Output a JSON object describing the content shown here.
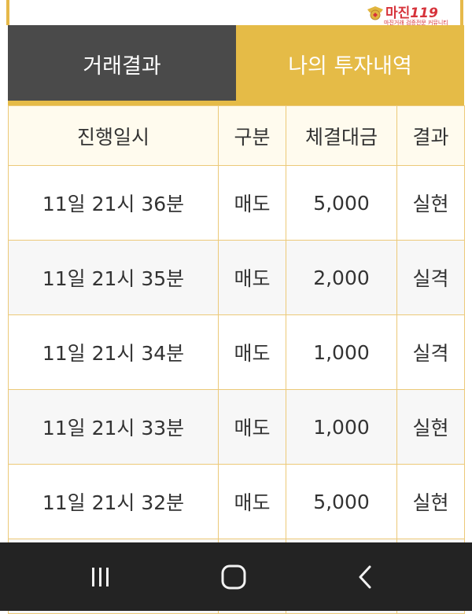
{
  "logo": {
    "name": "마진",
    "number": "119",
    "tagline": "마진거래 검증전문 커뮤니티"
  },
  "tabs": [
    {
      "label": "거래결과",
      "active": false
    },
    {
      "label": "나의 투자내역",
      "active": true
    }
  ],
  "table": {
    "headers": [
      "진행일시",
      "구분",
      "체결대금",
      "결과"
    ],
    "rows": [
      {
        "time": "11일 21시 36분",
        "type": "매도",
        "amount": "5,000",
        "result": "실현"
      },
      {
        "time": "11일 21시 35분",
        "type": "매도",
        "amount": "2,000",
        "result": "실격"
      },
      {
        "time": "11일 21시 34분",
        "type": "매도",
        "amount": "1,000",
        "result": "실격"
      },
      {
        "time": "11일 21시 33분",
        "type": "매도",
        "amount": "1,000",
        "result": "실현"
      },
      {
        "time": "11일 21시 32분",
        "type": "매도",
        "amount": "5,000",
        "result": "실현"
      }
    ]
  },
  "navbar": {
    "icons": [
      "recent-apps-icon",
      "home-icon",
      "back-icon"
    ]
  },
  "colors": {
    "accent": "#e5bb47",
    "dark_tab": "#4a4a4a",
    "sell": "#2b9ad6",
    "win": "#d9343a",
    "lose": "#2b9ad6",
    "navbar": "#232323"
  }
}
